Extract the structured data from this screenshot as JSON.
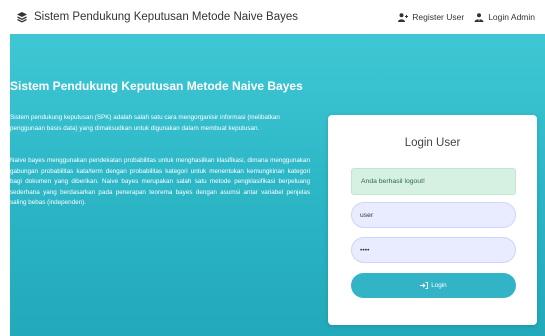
{
  "navbar": {
    "brand_icon": "layers-icon",
    "brand_title": "Sistem Pendukung Keputusan Metode Naive Bayes",
    "links": [
      {
        "icon": "user-plus-icon",
        "label": "Register User"
      },
      {
        "icon": "user-tie-icon",
        "label": "Login Admin"
      }
    ]
  },
  "hero": {
    "title": "Sistem Pendukung Keputusan Metode Naive Bayes",
    "paragraph1": "Sistem pendukung keputusan (SPK) adalah salah satu cara mengorganisir informasi (melibatkan penggunaan basis data) yang dimaksudkan untuk digunakan dalam membuat keputusan.",
    "paragraph2": "Naive bayes menggunakan pendekatan probabilitas untuk menghasilkan klasifikasi, dimana menggunakan gabungan probabilitas kata/term dengan probabilitas kategori untuk menentukan kemungkinan kategori bagi dokumen yang diberikan. Naive bayes merupakan salah satu metode pengklasifikasi berpeluang sederhana yang berdasarkan pada penerapan teorema bayes dengan asumsi antar variabel penjelas saling bebas (independen)."
  },
  "login": {
    "title": "Login User",
    "alert": "Anda berhasil logout!",
    "username_value": "user",
    "password_value": "••••",
    "button_label": "Login",
    "button_icon": "sign-in-icon"
  },
  "colors": {
    "hero_top": "#3fc7d4",
    "hero_bottom": "#22a9ba",
    "button": "#33b4c6",
    "alert_bg": "#d6f1e2",
    "input_bg": "#e9ecff"
  }
}
